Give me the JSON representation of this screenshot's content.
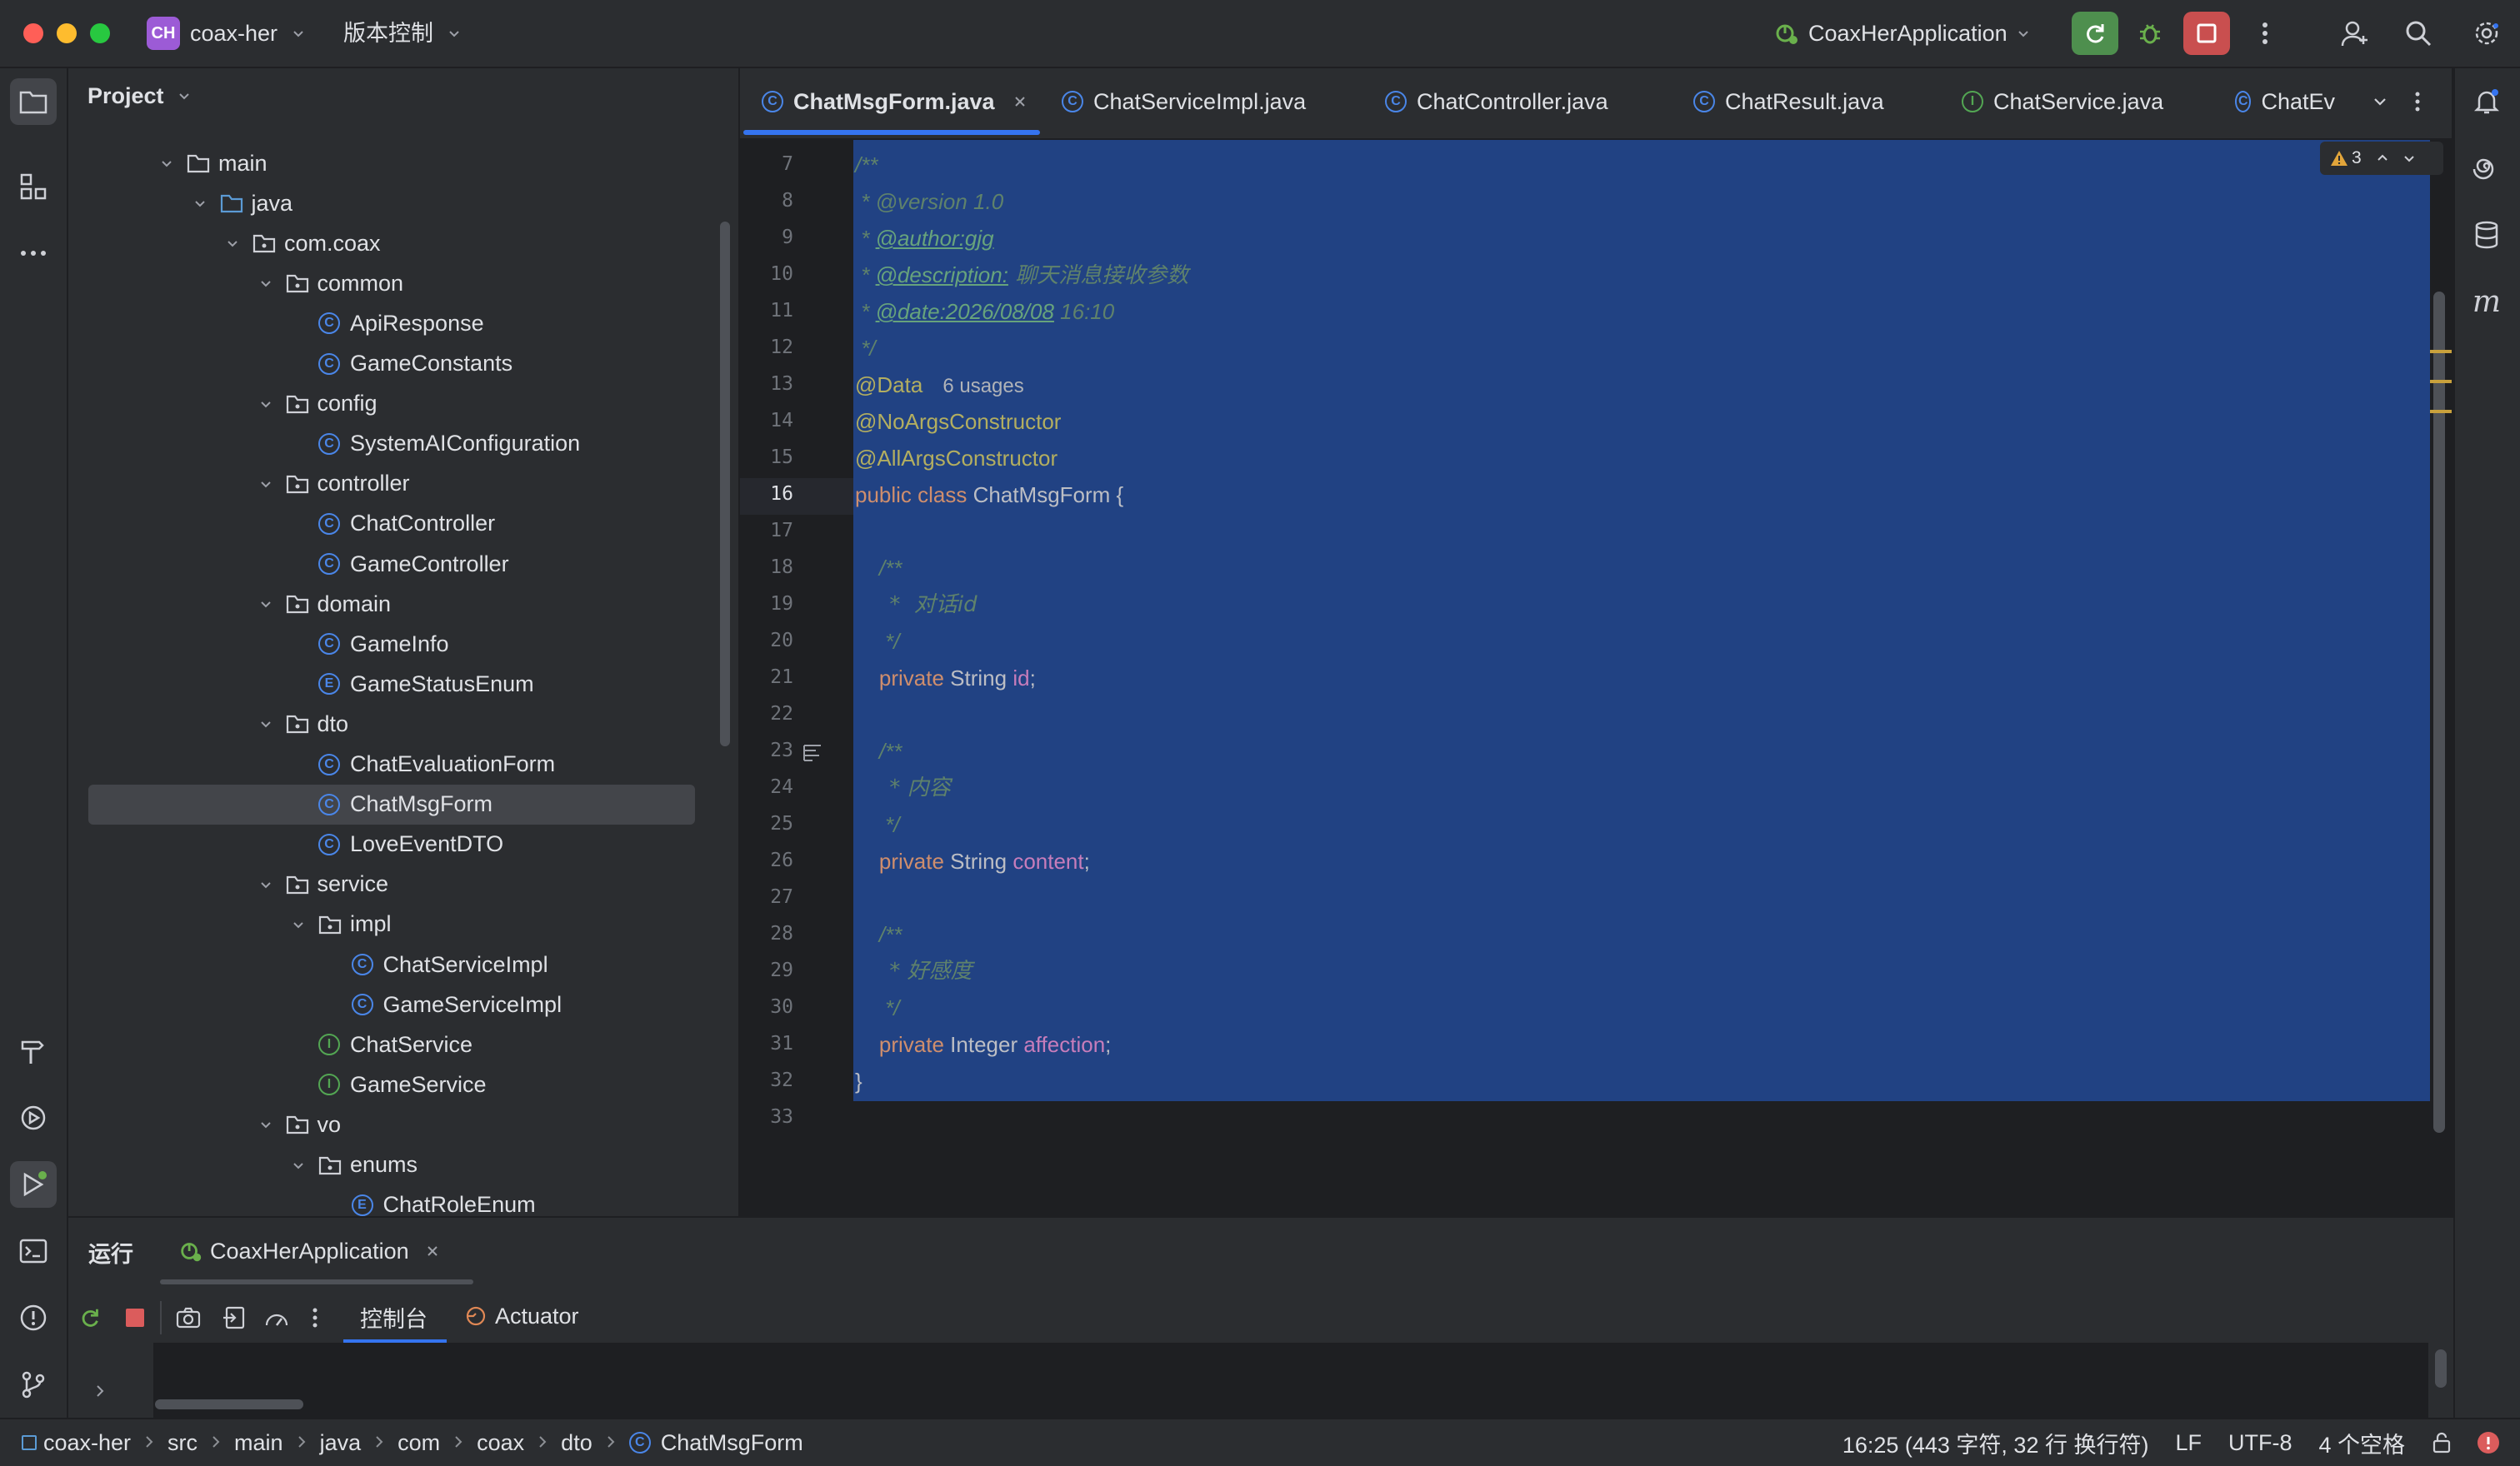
{
  "titlebar": {
    "project_badge": "CH",
    "project_name": "coax-her",
    "vcs_label": "版本控制",
    "run_config": "CoaxHerApplication"
  },
  "project_panel": {
    "title": "Project",
    "tree": [
      {
        "label": "main",
        "kind": "folder",
        "depth": 0,
        "expanded": true
      },
      {
        "label": "java",
        "kind": "folder-src",
        "depth": 1,
        "expanded": true
      },
      {
        "label": "com.coax",
        "kind": "package",
        "depth": 2,
        "expanded": true
      },
      {
        "label": "common",
        "kind": "package",
        "depth": 3,
        "expanded": true
      },
      {
        "label": "ApiResponse",
        "kind": "class",
        "depth": 4
      },
      {
        "label": "GameConstants",
        "kind": "class",
        "depth": 4
      },
      {
        "label": "config",
        "kind": "package",
        "depth": 3,
        "expanded": true
      },
      {
        "label": "SystemAIConfiguration",
        "kind": "class",
        "depth": 4
      },
      {
        "label": "controller",
        "kind": "package",
        "depth": 3,
        "expanded": true
      },
      {
        "label": "ChatController",
        "kind": "class",
        "depth": 4
      },
      {
        "label": "GameController",
        "kind": "class",
        "depth": 4
      },
      {
        "label": "domain",
        "kind": "package",
        "depth": 3,
        "expanded": true
      },
      {
        "label": "GameInfo",
        "kind": "class",
        "depth": 4
      },
      {
        "label": "GameStatusEnum",
        "kind": "enum",
        "depth": 4
      },
      {
        "label": "dto",
        "kind": "package",
        "depth": 3,
        "expanded": true
      },
      {
        "label": "ChatEvaluationForm",
        "kind": "class",
        "depth": 4
      },
      {
        "label": "ChatMsgForm",
        "kind": "class",
        "depth": 4,
        "selected": true
      },
      {
        "label": "LoveEventDTO",
        "kind": "class",
        "depth": 4
      },
      {
        "label": "service",
        "kind": "package",
        "depth": 3,
        "expanded": true
      },
      {
        "label": "impl",
        "kind": "package",
        "depth": 4,
        "expanded": true
      },
      {
        "label": "ChatServiceImpl",
        "kind": "class",
        "depth": 5
      },
      {
        "label": "GameServiceImpl",
        "kind": "class",
        "depth": 5
      },
      {
        "label": "ChatService",
        "kind": "interface",
        "depth": 4
      },
      {
        "label": "GameService",
        "kind": "interface",
        "depth": 4
      },
      {
        "label": "vo",
        "kind": "package",
        "depth": 3,
        "expanded": true
      },
      {
        "label": "enums",
        "kind": "package",
        "depth": 4,
        "expanded": true
      },
      {
        "label": "ChatRoleEnum",
        "kind": "enum",
        "depth": 5
      }
    ]
  },
  "editor": {
    "tabs": [
      {
        "label": "ChatMsgForm.java",
        "active": true,
        "kind": "class"
      },
      {
        "label": "ChatServiceImpl.java",
        "kind": "class"
      },
      {
        "label": "ChatController.java",
        "kind": "class"
      },
      {
        "label": "ChatResult.java",
        "kind": "class"
      },
      {
        "label": "ChatService.java",
        "kind": "interface"
      },
      {
        "label": "ChatEv",
        "kind": "class"
      }
    ],
    "warning_count": "3",
    "current_line": "16",
    "line_numbers": [
      "7",
      "8",
      "9",
      "10",
      "11",
      "12",
      "13",
      "14",
      "15",
      "16",
      "17",
      "18",
      "19",
      "20",
      "21",
      "22",
      "23",
      "24",
      "25",
      "26",
      "27",
      "28",
      "29",
      "30",
      "31",
      "32",
      "33"
    ],
    "code": {
      "l7": "/**",
      "l8_star": " * ",
      "l8_tag": "@version",
      "l8_val": " 1.0",
      "l9_tag": "@author:gjg",
      "l10_tag": "@description:",
      "l10_val": " 聊天消息接收参数",
      "l11_tag": "@date:2026/08/08",
      "l11_val": " 16:10",
      "l12": " */",
      "l13_ann": "@Data",
      "l13_hint": "6 usages",
      "l14": "@NoArgsConstructor",
      "l15": "@AllArgsConstructor",
      "l16_kw": "public class",
      "l16_rest": " ChatMsgForm {",
      "l18": "    /**",
      "l19": "     *  对话id",
      "l20": "     */",
      "l21_kw": "    private",
      "l21_type": " String ",
      "l21_fld": "id",
      "l22": "",
      "l23": "    /**",
      "l24": "     * 内容",
      "l25": "     */",
      "l26_kw": "    private",
      "l26_type": " String ",
      "l26_fld": "content",
      "l28": "    /**",
      "l29": "     * 好感度",
      "l30": "     */",
      "l31_kw": "    private",
      "l31_type": " Integer ",
      "l31_fld": "affection",
      "l32": "}"
    }
  },
  "run_panel": {
    "title": "运行",
    "config_tab": "CoaxHerApplication",
    "console_tab": "控制台",
    "actuator_tab": "Actuator"
  },
  "statusbar": {
    "breadcrumbs": [
      "coax-her",
      "src",
      "main",
      "java",
      "com",
      "coax",
      "dto",
      "ChatMsgForm"
    ],
    "position": "16:25 (443 字符, 32 行 换行符)",
    "line_sep": "LF",
    "encoding": "UTF-8",
    "indent": "4 个空格"
  },
  "colors": {
    "accent": "#3574f0",
    "selection": "#214283",
    "run_green": "#4e8f4e",
    "stop_red": "#c94f4f"
  }
}
